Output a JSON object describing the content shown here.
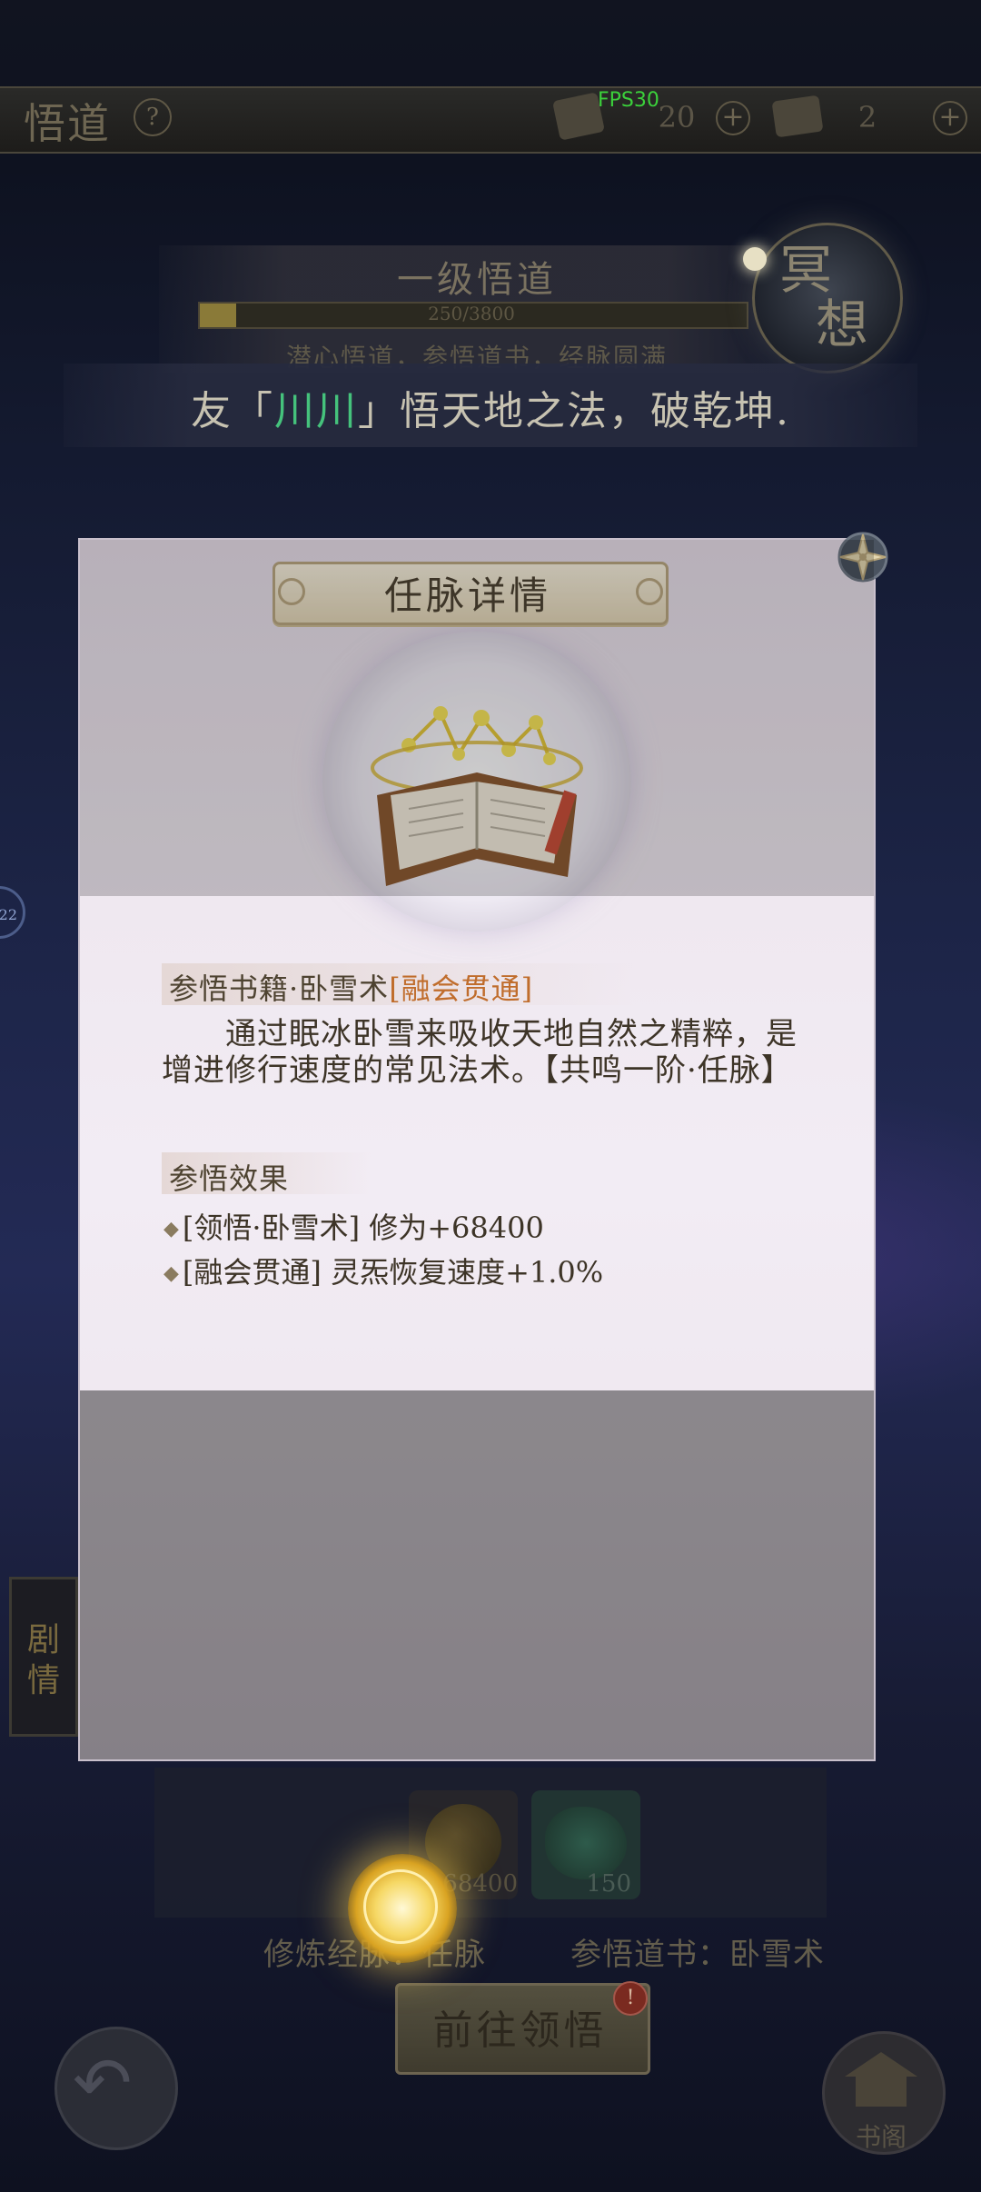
{
  "top_bar": {
    "title": "悟道",
    "help_glyph": "?",
    "resource_1_value": "20",
    "resource_2_value": "2",
    "plus_glyph": "+",
    "fps": "FPS30"
  },
  "level": {
    "title": "一级悟道",
    "progress_text": "250/3800",
    "progress_fraction": 0.066,
    "subtitle": "潜心悟道，参悟道书，经脉圆满"
  },
  "meditate": {
    "char_1": "冥",
    "char_2": "想"
  },
  "announcement": {
    "prefix": "友「",
    "name": "川川",
    "suffix": "」悟天地之法，破乾坤."
  },
  "side": {
    "badge_text": "22",
    "story_char_1": "剧",
    "story_char_2": "情"
  },
  "modal": {
    "title": "任脉详情",
    "book_title": "参悟书籍·卧雪术",
    "book_mastery": "[融会贯通]",
    "description": "通过眠冰卧雪来吸收天地自然之精粹，是增进修行速度的常见法术。【共鸣一阶·任脉】",
    "effects_heading": "参悟效果",
    "effects": [
      "[领悟·卧雪术] 修为+68400",
      "[融会贯通] 灵炁恢复速度+1.0%"
    ],
    "bullet": "◆"
  },
  "bottom": {
    "item_1_count": "68400",
    "item_2_count": "150",
    "label_cultivate": "修炼经脉：任脉",
    "label_book": "参悟道书：卧雪术",
    "goto_button": "前往领悟",
    "goto_badge": "!",
    "library_label": "书阁",
    "back_glyph": "↶"
  },
  "colors": {
    "accent_name": "#45c27c",
    "mastery": "#c06d2c",
    "modal_bg": "#efe8f0"
  }
}
